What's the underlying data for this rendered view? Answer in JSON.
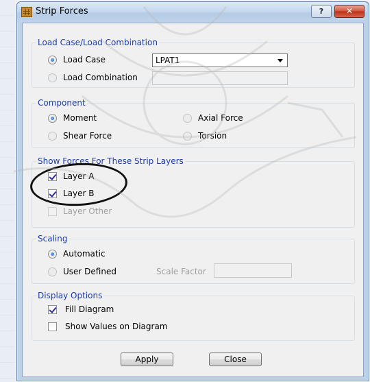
{
  "window": {
    "title": "Strip Forces",
    "help_label": "?",
    "close_label": "✕"
  },
  "load_group": {
    "legend": "Load Case/Load Combination",
    "load_case_label": "Load Case",
    "load_combination_label": "Load Combination",
    "selected": "Load Case",
    "load_case_value": "LPAT1"
  },
  "component_group": {
    "legend": "Component",
    "options": [
      "Moment",
      "Axial Force",
      "Shear Force",
      "Torsion"
    ],
    "selected": "Moment"
  },
  "layers_group": {
    "legend": "Show Forces For These Strip Layers",
    "items": [
      {
        "label": "Layer A",
        "checked": true,
        "enabled": true
      },
      {
        "label": "Layer B",
        "checked": true,
        "enabled": true
      },
      {
        "label": "Layer Other",
        "checked": false,
        "enabled": false
      }
    ]
  },
  "scaling_group": {
    "legend": "Scaling",
    "automatic_label": "Automatic",
    "user_defined_label": "User Defined",
    "scale_factor_label": "Scale Factor",
    "scale_factor_value": "",
    "selected": "Automatic"
  },
  "display_group": {
    "legend": "Display Options",
    "fill_diagram_label": "Fill Diagram",
    "fill_diagram_checked": true,
    "show_values_label": "Show Values on Diagram",
    "show_values_checked": false
  },
  "buttons": {
    "apply_label": "Apply",
    "close_label": "Close"
  },
  "colors": {
    "legend_text": "#1e3ca8",
    "title_bar": "#c6d9ee",
    "close_button": "#c43b22",
    "annotation_ellipse": "#111111"
  }
}
